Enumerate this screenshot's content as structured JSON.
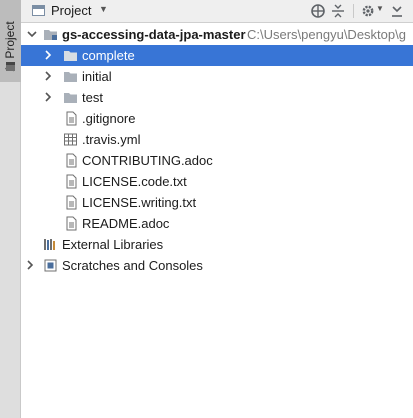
{
  "tool_window": {
    "stripe_label": "1: Project"
  },
  "header": {
    "title": "Project"
  },
  "tree": {
    "root": {
      "name": "gs-accessing-data-jpa-master",
      "path": "C:\\Users\\pengyu\\Desktop\\g"
    },
    "items": [
      {
        "name": "complete",
        "type": "folder",
        "expandable": true,
        "selected": true
      },
      {
        "name": "initial",
        "type": "folder",
        "expandable": true,
        "selected": false
      },
      {
        "name": "test",
        "type": "folder",
        "expandable": true,
        "selected": false
      },
      {
        "name": ".gitignore",
        "type": "file-text",
        "expandable": false
      },
      {
        "name": ".travis.yml",
        "type": "file-yaml",
        "expandable": false
      },
      {
        "name": "CONTRIBUTING.adoc",
        "type": "file-text",
        "expandable": false
      },
      {
        "name": "LICENSE.code.txt",
        "type": "file-text",
        "expandable": false
      },
      {
        "name": "LICENSE.writing.txt",
        "type": "file-text",
        "expandable": false
      },
      {
        "name": "README.adoc",
        "type": "file-text",
        "expandable": false
      }
    ],
    "external_libraries": "External Libraries",
    "scratches": "Scratches and Consoles"
  },
  "colors": {
    "selection": "#3875d6",
    "folder": "#a9b0b9",
    "path_text": "#7a7a7a"
  },
  "icons": [
    "project-icon",
    "globe-icon",
    "collapse-all-icon",
    "gear-icon",
    "hide-icon",
    "folder-icon",
    "file-text-icon",
    "file-yaml-icon",
    "libraries-icon",
    "scratches-icon"
  ]
}
